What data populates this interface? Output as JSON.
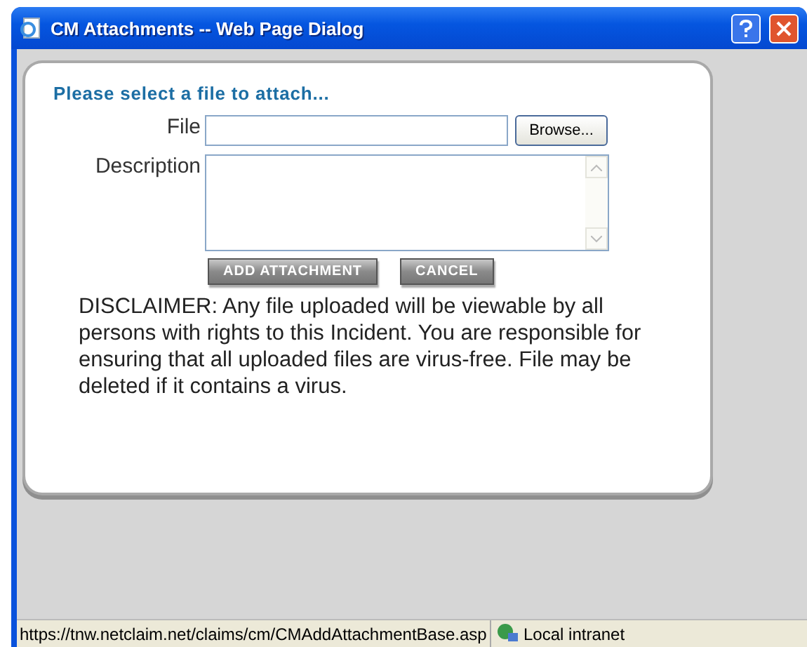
{
  "window": {
    "title": "CM Attachments -- Web Page Dialog"
  },
  "form": {
    "heading": "Please select a file to attach...",
    "file_label": "File",
    "browse_button": "Browse...",
    "description_label": "Description",
    "buttons": [
      "ADD ATTACHMENT",
      "CANCEL"
    ],
    "disclaimer": "DISCLAIMER: Any file uploaded will be viewable by all persons with rights to this Incident. You are responsible for ensuring that all uploaded files are virus-free. File may be deleted if it contains a virus."
  },
  "status_bar": {
    "url": "https://tnw.netclaim.net/claims/cm/CMAddAttachmentBase.asp",
    "zone": "Local intranet"
  }
}
